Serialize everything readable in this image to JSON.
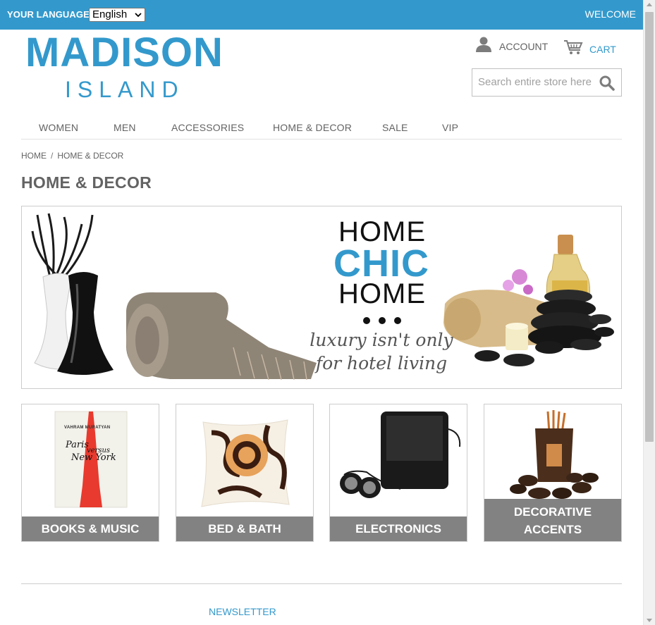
{
  "topbar": {
    "language_label": "YOUR LANGUAGE:",
    "language_selected": "English",
    "welcome": "WELCOME",
    "bg_color": "#3399cc"
  },
  "logo": {
    "line1": "MADISON",
    "line2": "ISLAND"
  },
  "header": {
    "account_label": "ACCOUNT",
    "cart_label": "CART",
    "search_placeholder": "Search entire store here...",
    "accent_color": "#3399cc"
  },
  "nav": {
    "items": [
      "WOMEN",
      "MEN",
      "ACCESSORIES",
      "HOME & DECOR",
      "SALE",
      "VIP"
    ]
  },
  "breadcrumb": {
    "home": "HOME",
    "separator": "/",
    "current": "HOME & DECOR"
  },
  "page": {
    "title": "HOME & DECOR"
  },
  "banner": {
    "line1": "HOME",
    "line2": "CHIC",
    "line3": "HOME",
    "tagline1": "luxury isn't only",
    "tagline2": "for hotel living"
  },
  "categories": [
    {
      "label": "BOOKS & MUSIC",
      "book_author": "VAHRAM MURATYAN",
      "book_title_1": "Paris",
      "book_title_2": "versus",
      "book_title_3": "New York"
    },
    {
      "label": "BED & BATH"
    },
    {
      "label": "ELECTRONICS"
    },
    {
      "label_line1": "DECORATIVE",
      "label_line2": "ACCENTS"
    }
  ],
  "footer": {
    "newsletter": "NEWSLETTER"
  }
}
